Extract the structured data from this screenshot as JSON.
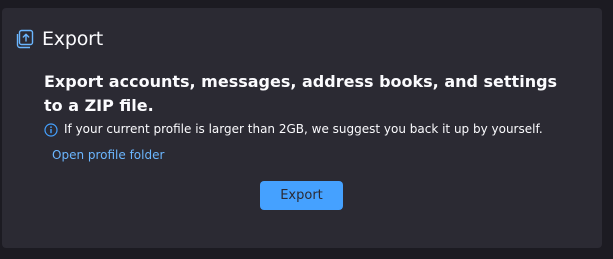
{
  "panel": {
    "title": "Export",
    "icon": "export-icon",
    "heading": "Export accounts, messages, address books, and settings to a ZIP file.",
    "info_icon": "info-icon",
    "info_text": "If your current profile is larger than 2GB, we suggest you back it up by yourself.",
    "link_label": "Open profile folder",
    "button_label": "Export"
  },
  "colors": {
    "background": "#1c1b22",
    "card": "#2b2a33",
    "text": "#fbfbfe",
    "link": "#6bb6ff",
    "accent": "#45a1ff"
  }
}
